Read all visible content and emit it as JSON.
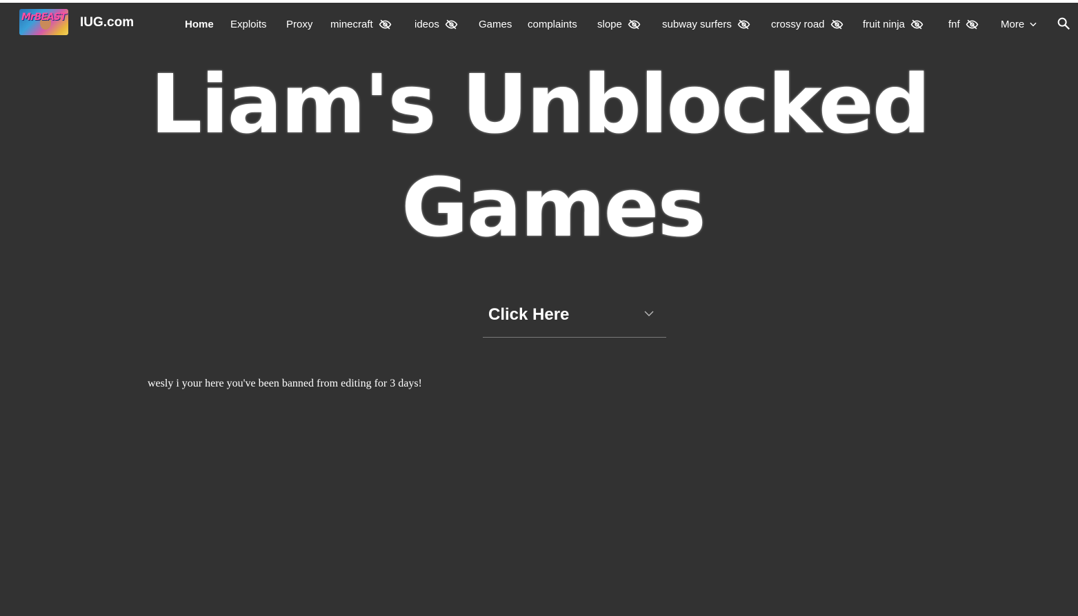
{
  "header": {
    "site_title": "IUG.com",
    "logo_text": "MrBEAST",
    "nav": [
      {
        "label": "Home",
        "active": true,
        "hidden_icon": false
      },
      {
        "label": "Exploits",
        "active": false,
        "hidden_icon": false
      },
      {
        "label": "Proxy",
        "active": false,
        "hidden_icon": false
      },
      {
        "label": "minecraft",
        "active": false,
        "hidden_icon": true
      },
      {
        "label": "ideos",
        "active": false,
        "hidden_icon": true
      },
      {
        "label": "Games",
        "active": false,
        "hidden_icon": false
      },
      {
        "label": "complaints",
        "active": false,
        "hidden_icon": false
      },
      {
        "label": "slope",
        "active": false,
        "hidden_icon": true
      },
      {
        "label": "subway surfers",
        "active": false,
        "hidden_icon": true
      },
      {
        "label": "crossy road",
        "active": false,
        "hidden_icon": true
      },
      {
        "label": "fruit ninja",
        "active": false,
        "hidden_icon": true
      },
      {
        "label": "fnf",
        "active": false,
        "hidden_icon": true
      },
      {
        "label": "More",
        "active": false,
        "hidden_icon": false
      }
    ],
    "icons": {
      "hidden_page": "eye-off-icon",
      "more": "chevron-down-icon",
      "search": "search-icon"
    }
  },
  "hero": {
    "line1": "Liam's Unblocked",
    "line2": "Games"
  },
  "dropdown": {
    "label": "Click Here",
    "icon": "chevron-down-icon"
  },
  "notice": {
    "text": "wesly i your here you've been banned from editing for 3 days!"
  },
  "colors": {
    "background": "#323232",
    "text": "#ffffff",
    "divider": "#7a7a7a"
  }
}
